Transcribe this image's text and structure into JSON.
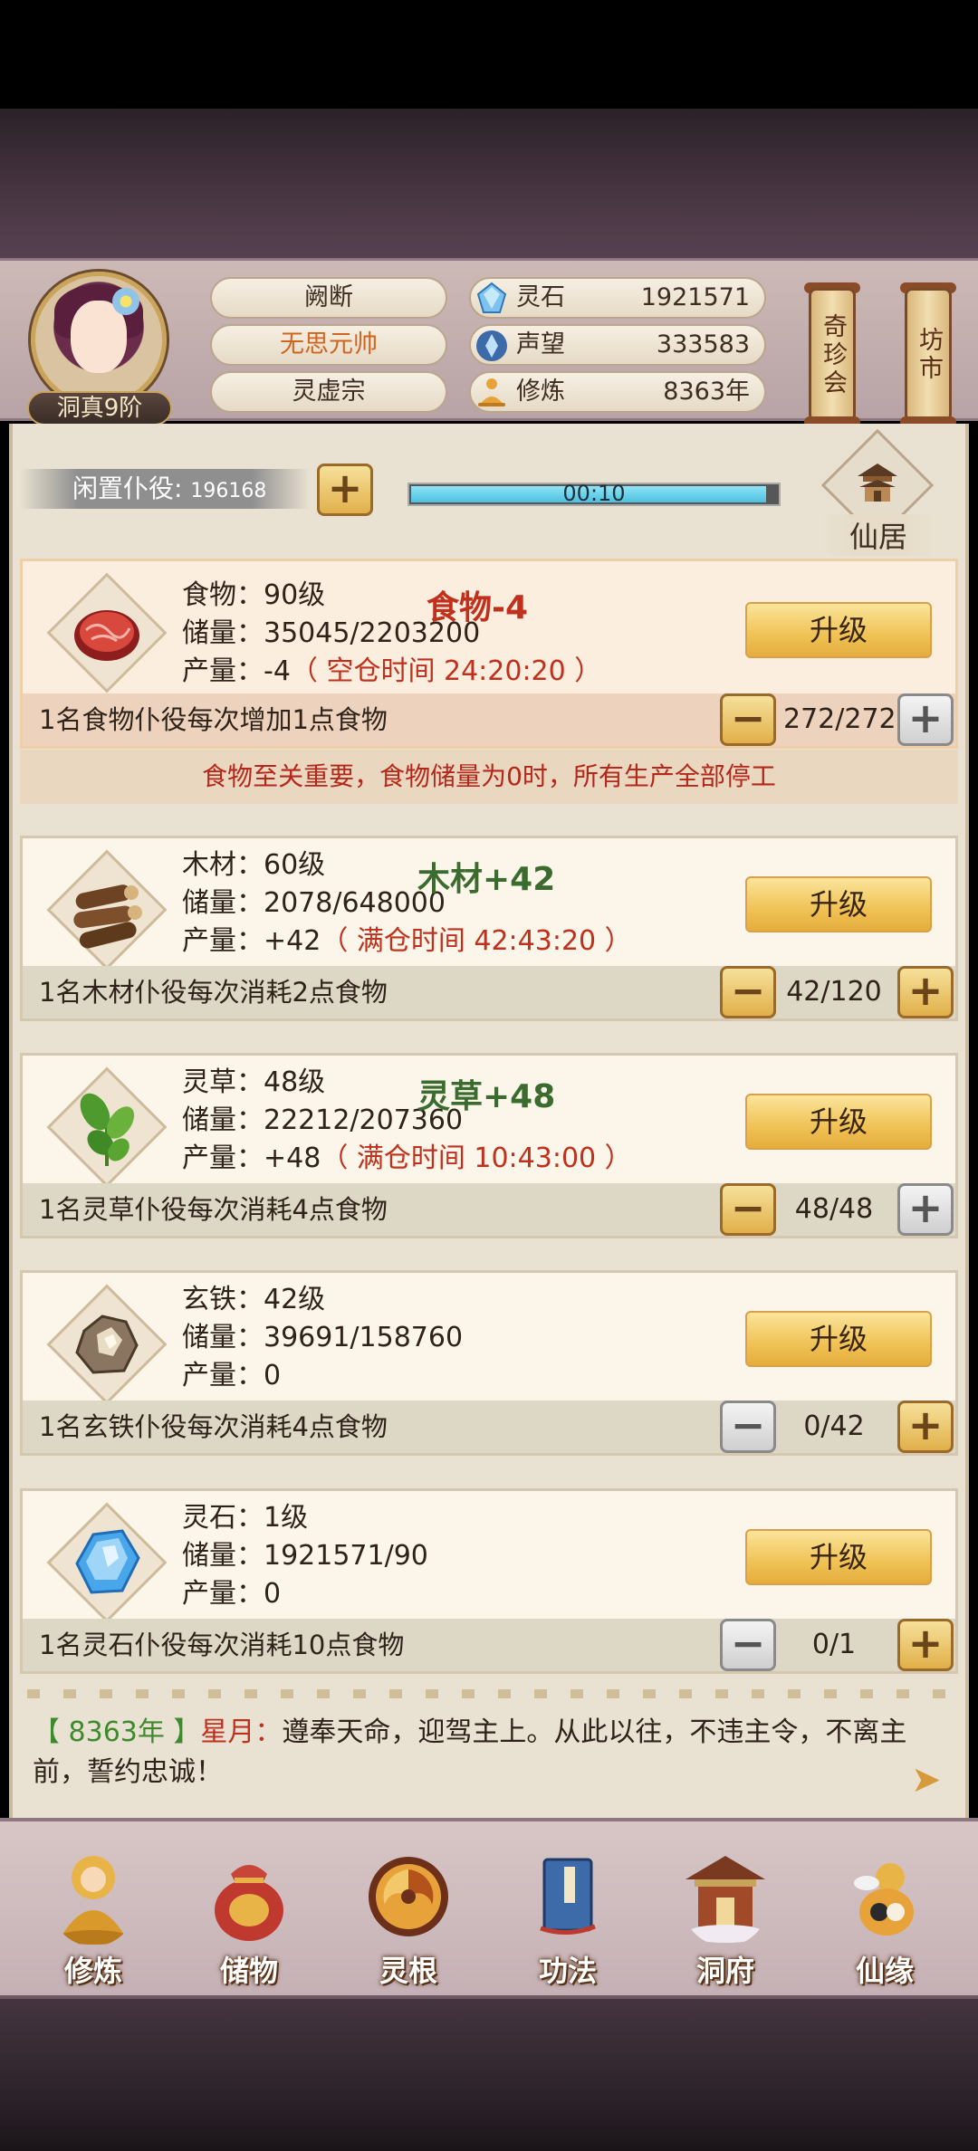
{
  "header": {
    "rank": "洞真9阶",
    "names": [
      "阙断",
      "无思元帅",
      "灵虚宗"
    ],
    "resources": [
      {
        "label": "灵石",
        "value": "1921571",
        "icon": "spirit-stone-icon"
      },
      {
        "label": "声望",
        "value": "333583",
        "icon": "prestige-icon"
      },
      {
        "label": "修炼",
        "value": "8363年",
        "icon": "meditation-icon"
      }
    ],
    "shop_buttons": [
      "奇珍会",
      "坊市"
    ]
  },
  "idle": {
    "label": "闲置仆役",
    "count": "196168",
    "plus": "+",
    "timer": "00:10",
    "timer_progress": 0.97
  },
  "xianju": {
    "label": "仙居"
  },
  "cards": [
    {
      "name": "食物：90级",
      "storage": "储量：35045/2203200",
      "output_prefix": "产量：-4",
      "output_note": "（ 空仓时间 24:20:20 ）",
      "float": "食物-4",
      "upgrade": "升级",
      "desc": "1名食物仆役每次增加1点食物",
      "count": "272/272",
      "minus": "−",
      "plus": "+"
    },
    {
      "name": "木材：60级",
      "storage": "储量：2078/648000",
      "output_prefix": "产量：+42",
      "output_note": "（ 满仓时间 42:43:20 ）",
      "float": "木材+42",
      "upgrade": "升级",
      "desc": "1名木材仆役每次消耗2点食物",
      "count": "42/120",
      "minus": "−",
      "plus": "+"
    },
    {
      "name": "灵草：48级",
      "storage": "储量：22212/207360",
      "output_prefix": "产量：+48",
      "output_note": "（ 满仓时间 10:43:00 ）",
      "float": "灵草+48",
      "upgrade": "升级",
      "desc": "1名灵草仆役每次消耗4点食物",
      "count": "48/48",
      "minus": "−",
      "plus": "+"
    },
    {
      "name": "玄铁：42级",
      "storage": "储量：39691/158760",
      "output_prefix": "产量：0",
      "output_note": "",
      "float": "",
      "upgrade": "升级",
      "desc": "1名玄铁仆役每次消耗4点食物",
      "count": "0/42",
      "minus": "−",
      "plus": "+"
    },
    {
      "name": "灵石：1级",
      "storage": "储量：1921571/90",
      "output_prefix": "产量：0",
      "output_note": "",
      "float": "",
      "upgrade": "升级",
      "desc": "1名灵石仆役每次消耗10点食物",
      "count": "0/1",
      "minus": "−",
      "plus": "+"
    }
  ],
  "warning": "食物至关重要，食物储量为0时，所有生产全部停工",
  "log": {
    "year": "【 8363年 】",
    "speaker": "星月：",
    "text": "遵奉天命，迎驾主上。从此以往，不违主令，不离主前，誓约忠诚！"
  },
  "nav": [
    "修炼",
    "储物",
    "灵根",
    "功法",
    "洞府",
    "仙缘"
  ],
  "colors": {
    "accent_gold": "#f0c255",
    "warning_red": "#c0301d",
    "gain_green": "#3b6b2e",
    "timer_cyan": "#4cc0e0"
  }
}
